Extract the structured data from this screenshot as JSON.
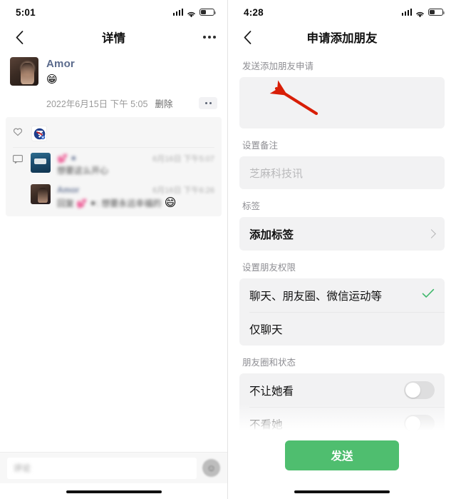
{
  "left_panel": {
    "status": {
      "time": "5:01",
      "signal_icon": "signal-bars-icon",
      "wifi_icon": "wifi-icon",
      "battery_icon": "battery-low-icon"
    },
    "nav": {
      "back_icon": "chevron-left-icon",
      "title": "详情",
      "more_icon": "more-dots-icon"
    },
    "moment": {
      "author": "Amor",
      "content_emoji": "😁",
      "timestamp": "2022年6月15日 下午 5:05",
      "delete_label": "删除",
      "actions_icon": "two-dots-icon"
    },
    "likes": {
      "heart_icon": "heart-icon",
      "liker_avatar": "zhima-logo-avatar"
    },
    "comments": {
      "comment_icon": "comment-bubble-icon",
      "items": [
        {
          "name": "💕 ⁕",
          "time": "6月16日 下午5:07",
          "text": "想要这么开心",
          "avatar": "photo-avatar-blue"
        },
        {
          "name": "Amor",
          "time": "6月16日 下午6:26",
          "text": "回复 💕 ⁕: 想要永远幸福的",
          "emoji": "😄",
          "avatar": "photo-avatar-dark"
        }
      ]
    },
    "input_bar": {
      "placeholder": "评论",
      "emoji_button_icon": "emoji-face-icon"
    },
    "home_indicator": "home-indicator"
  },
  "right_panel": {
    "status": {
      "time": "4:28",
      "signal_icon": "signal-bars-icon",
      "wifi_icon": "wifi-icon",
      "battery_icon": "battery-low-icon"
    },
    "nav": {
      "back_icon": "chevron-left-icon",
      "title": "申请添加朋友"
    },
    "sections": {
      "request": {
        "label": "发送添加朋友申请",
        "value": ""
      },
      "remark": {
        "label": "设置备注",
        "placeholder": "芝麻科技讯",
        "value": ""
      },
      "tags": {
        "label": "标签",
        "row_label": "添加标签",
        "chevron_icon": "chevron-right-icon"
      },
      "permission": {
        "label": "设置朋友权限",
        "options": [
          {
            "label": "聊天、朋友圈、微信运动等",
            "selected": true,
            "check_icon": "check-icon"
          },
          {
            "label": "仅聊天",
            "selected": false
          }
        ]
      },
      "moments_status": {
        "label": "朋友圈和状态",
        "rows": [
          {
            "label": "不让她看",
            "toggle": "off"
          },
          {
            "label": "不看她",
            "toggle": "off"
          }
        ]
      }
    },
    "send_button": "发送",
    "annotation": {
      "type": "red-arrow",
      "color": "#d81e06"
    },
    "home_indicator": "home-indicator"
  }
}
